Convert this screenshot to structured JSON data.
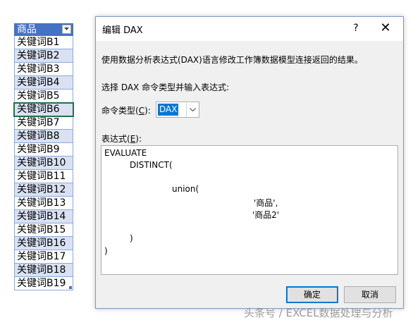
{
  "excel": {
    "header": "商品",
    "rows": [
      "关键词B1",
      "关键词B2",
      "关键词B3",
      "关键词B4",
      "关键词B5",
      "关键词B6",
      "关键词B7",
      "关键词B8",
      "关键词B9",
      "关键词B10",
      "关键词B11",
      "关键词B12",
      "关键词B13",
      "关键词B14",
      "关键词B15",
      "关键词B16",
      "关键词B17",
      "关键词B18",
      "关键词B19"
    ],
    "selected_row": "关键词B6"
  },
  "dialog": {
    "title": "编辑 DAX",
    "help": "?",
    "close": "✕",
    "description": "使用数据分析表达式(DAX)语言修改工作簿数据模型连接返回的结果。",
    "prompt": "选择 DAX 命令类型并输入表达式:",
    "command_type_label_pre": "命令类型(",
    "command_type_label_key": "C",
    "command_type_label_post": "):",
    "command_type_value": "DAX",
    "expression_label_pre": "表达式(",
    "expression_label_key": "E",
    "expression_label_post": "):",
    "expression_lines": [
      "EVALUATE",
      "DISTINCT(",
      "union(",
      "'商品',",
      "'商品2'",
      ")",
      ")"
    ],
    "ok_label": "确定",
    "cancel_label": "取消"
  },
  "watermark": "头条号 / EXCEL数据处理与分析"
}
